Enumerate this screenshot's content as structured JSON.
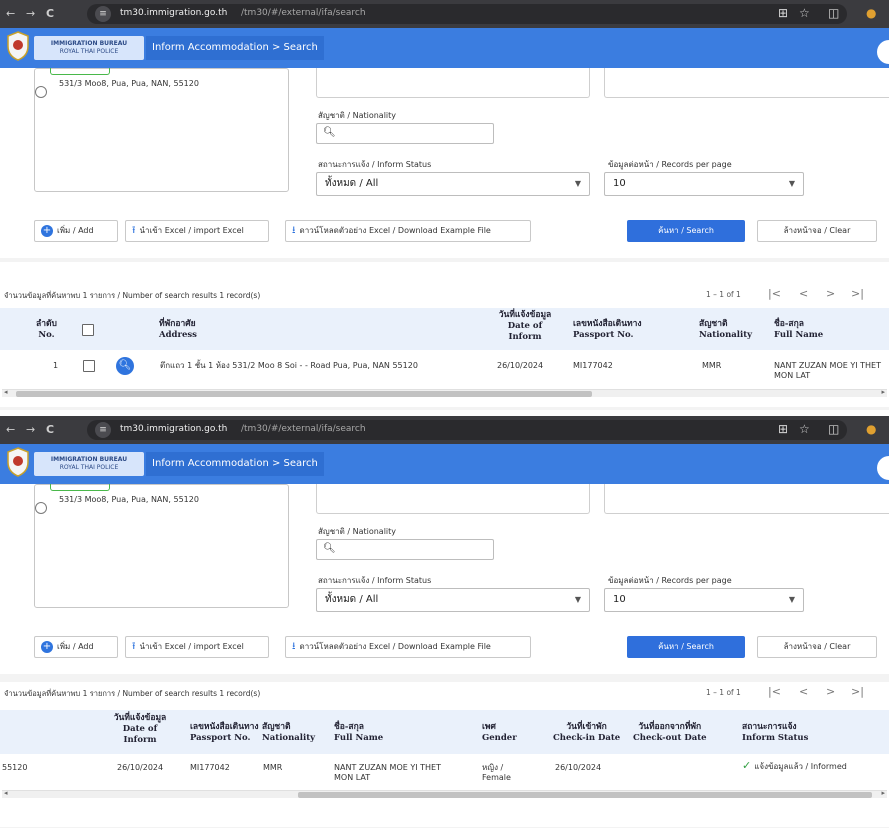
{
  "browser": {
    "back": "←",
    "forward": "→",
    "reload": "C",
    "host": "tm30.immigration.go.th",
    "path": "/tm30/#/external/ifa/search",
    "star": "☆"
  },
  "app": {
    "bureau_line1": "IMMIGRATION BUREAU",
    "bureau_line2": "ROYAL THAI POLICE",
    "breadcrumb": "Inform Accommodation > Search"
  },
  "form": {
    "address_text": "531/3 Moo8, Pua, Pua, NAN, 55120",
    "nationality_label": "สัญชาติ / Nationality",
    "nationality_value": "",
    "status_label": "สถานะการแจ้ง / Inform Status",
    "status_value": "ทั้งหมด / All",
    "per_page_label": "ข้อมูลต่อหน้า / Records per page",
    "per_page_value": "10"
  },
  "toolbar": {
    "add": "เพิ่ม / Add",
    "import": "นำเข้า Excel / import Excel",
    "download": "ดาวน์โหลดตัวอย่าง Excel / Download Example File",
    "search": "ค้นหา / Search",
    "clear": "ล้างหน้าจอ / Clear"
  },
  "results": {
    "count_text": "จำนวนข้อมูลที่ค้นหาพบ 1 รายการ / Number of search results 1 record(s)",
    "range": "1 – 1 of 1",
    "pager_first": "|<",
    "pager_prev": "<",
    "pager_next": ">",
    "pager_last": ">|"
  },
  "table1": {
    "headers": {
      "no_th": "ลำดับ",
      "no_en": "No.",
      "addr_th": "ที่พักอาศัย",
      "addr_en": "Address",
      "date_th": "วันที่แจ้งข้อมูล",
      "date_en1": "Date of",
      "date_en2": "Inform",
      "pass_th": "เลขหนังสือเดินทาง",
      "pass_en": "Passport No.",
      "nat_th": "สัญชาติ",
      "nat_en": "Nationality",
      "name_th": "ชื่อ-สกุล",
      "name_en": "Full Name"
    },
    "row": {
      "no": "1",
      "address": "ตึกแถว 1 ชั้น 1 ห้อง 531/2 Moo 8 Soi - - Road Pua, Pua, NAN 55120",
      "date": "26/10/2024",
      "passport": "MI177042",
      "nationality": "MMR",
      "name1": "NANT ZUZAN MOE YI THET",
      "name2": "MON LAT"
    }
  },
  "table2": {
    "headers": {
      "date_th": "วันที่แจ้งข้อมูล",
      "date_en1": "Date of",
      "date_en2": "Inform",
      "pass_th": "เลขหนังสือเดินทาง",
      "pass_en": "Passport No.",
      "nat_th": "สัญชาติ",
      "nat_en": "Nationality",
      "name_th": "ชื่อ-สกุล",
      "name_en": "Full Name",
      "gender_th": "เพศ",
      "gender_en": "Gender",
      "cin_th": "วันที่เข้าพัก",
      "cin_en": "Check-in Date",
      "cout_th": "วันที่ออกจากที่พัก",
      "cout_en": "Check-out Date",
      "status_th": "สถานะการแจ้ง",
      "status_en": "Inform Status"
    },
    "row": {
      "postcode": "55120",
      "date": "26/10/2024",
      "passport": "MI177042",
      "nationality": "MMR",
      "name1": "NANT ZUZAN MOE YI THET",
      "name2": "MON LAT",
      "gender1": "หญิง /",
      "gender2": "Female",
      "checkin": "26/10/2024",
      "checkout": "",
      "status": "แจ้งข้อมูลแล้ว / Informed"
    }
  },
  "colors": {
    "primary": "#2f6fdc",
    "header": "#3b7de0",
    "success": "#2f9e40"
  },
  "icons": [
    "shield-logo-icon",
    "search-icon",
    "plus-icon",
    "upload-icon",
    "download-icon",
    "check-icon",
    "star-icon"
  ]
}
